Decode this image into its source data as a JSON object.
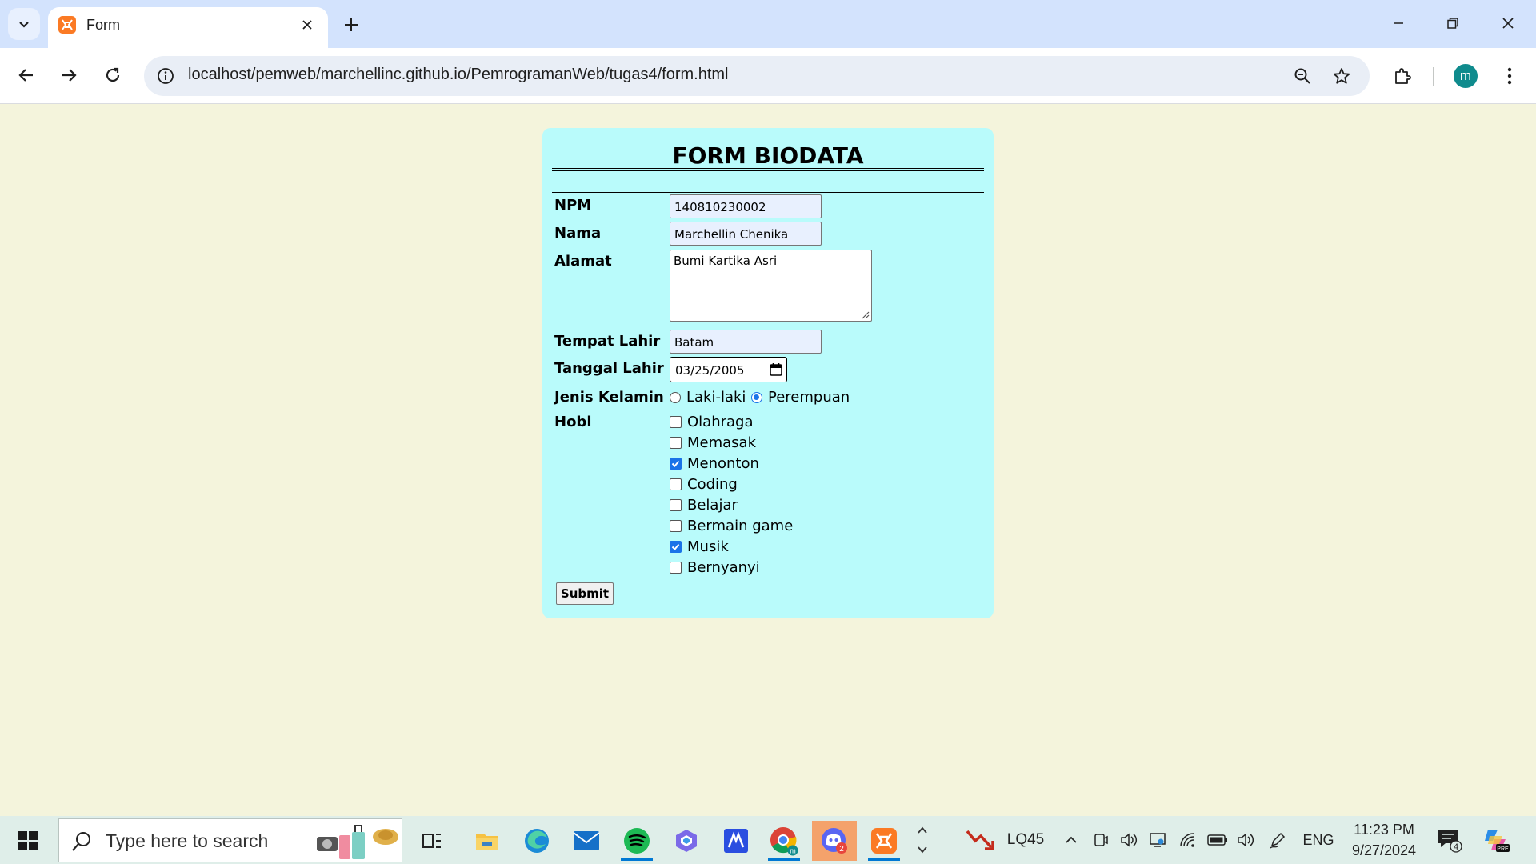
{
  "browser": {
    "tab_title": "Form",
    "url": "localhost/pemweb/marchellinc.github.io/PemrogramanWeb/tugas4/form.html",
    "profile_initial": "m"
  },
  "form": {
    "title": "FORM BIODATA",
    "fields": {
      "npm": {
        "label": "NPM",
        "value": "140810230002"
      },
      "nama": {
        "label": "Nama",
        "value": "Marchellin Chenika"
      },
      "alamat": {
        "label": "Alamat",
        "value": "Bumi Kartika Asri"
      },
      "tempat_lahir": {
        "label": "Tempat Lahir",
        "value": "Batam"
      },
      "tanggal_lahir": {
        "label": "Tanggal Lahir",
        "value": "03/25/2005"
      }
    },
    "gender": {
      "label": "Jenis Kelamin",
      "options": [
        {
          "label": "Laki-laki",
          "selected": false
        },
        {
          "label": "Perempuan",
          "selected": true
        }
      ]
    },
    "hobi": {
      "label": "Hobi",
      "options": [
        {
          "label": "Olahraga",
          "checked": false
        },
        {
          "label": "Memasak",
          "checked": false
        },
        {
          "label": "Menonton",
          "checked": true
        },
        {
          "label": "Coding",
          "checked": false
        },
        {
          "label": "Belajar",
          "checked": false
        },
        {
          "label": "Bermain game",
          "checked": false
        },
        {
          "label": "Musik",
          "checked": true
        },
        {
          "label": "Bernyanyi",
          "checked": false
        }
      ]
    },
    "submit_label": "Submit"
  },
  "taskbar": {
    "search_placeholder": "Type here to search",
    "stock_label": "LQ45",
    "language": "ENG",
    "time": "11:23 PM",
    "date": "9/27/2024",
    "notification_count": "4",
    "copilot_badge": "PRE",
    "discord_badge": "2"
  },
  "colors": {
    "page_bg": "#f4f4dc",
    "card_bg": "#b9fbfb",
    "accent": "#1a73e8"
  }
}
